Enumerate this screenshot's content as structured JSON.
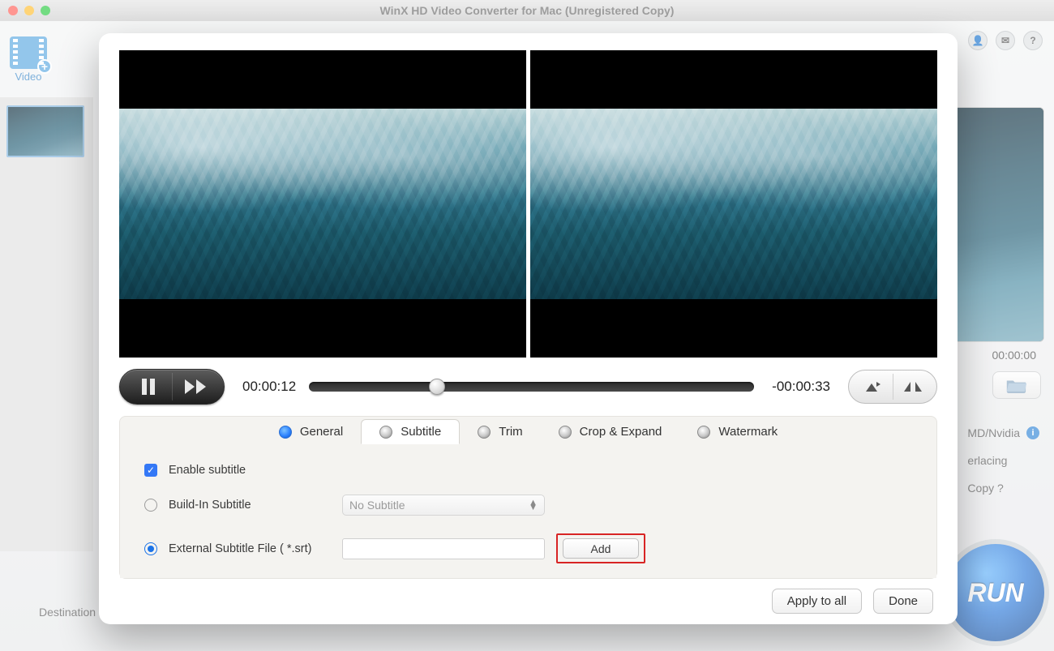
{
  "window": {
    "title": "WinX HD Video Converter for Mac (Unregistered Copy)"
  },
  "toolbar": {
    "video_label": "Video"
  },
  "right_panel": {
    "timecode": "00:00:00",
    "option_hw": "MD/Nvidia",
    "option_deint": "erlacing",
    "option_copy": "Copy ?",
    "run_label": "RUN"
  },
  "bottom": {
    "destination_label": "Destination"
  },
  "editor": {
    "time_current": "00:00:12",
    "time_remaining": "-00:00:33",
    "tabs": {
      "general": "General",
      "subtitle": "Subtitle",
      "trim": "Trim",
      "crop": "Crop & Expand",
      "watermark": "Watermark"
    },
    "subtitle_panel": {
      "enable_label": "Enable subtitle",
      "builtin_label": "Build-In Subtitle",
      "builtin_select": "No Subtitle",
      "external_label": "External Subtitle File ( *.srt)",
      "add_button": "Add"
    },
    "footer": {
      "apply_all": "Apply to all",
      "done": "Done"
    }
  }
}
